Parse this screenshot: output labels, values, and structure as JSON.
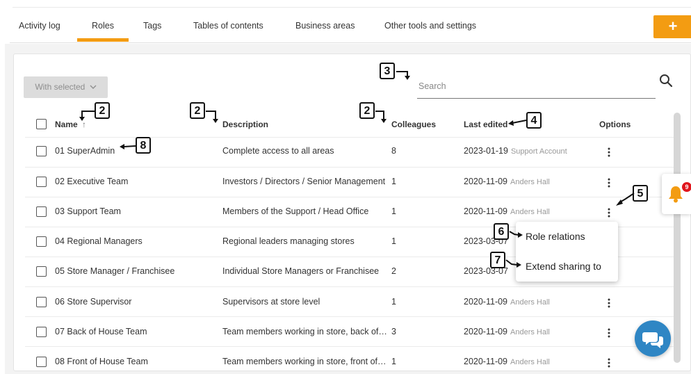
{
  "tabs": [
    {
      "label": "Activity log",
      "active": false
    },
    {
      "label": "Roles",
      "active": true
    },
    {
      "label": "Tags",
      "active": false
    },
    {
      "label": "Tables of contents",
      "active": false
    },
    {
      "label": "Business areas",
      "active": false
    },
    {
      "label": "Other tools and settings",
      "active": false
    }
  ],
  "add_button_label": "+",
  "toolbar": {
    "with_selected_label": "With selected",
    "search_placeholder": "Search"
  },
  "table": {
    "headers": {
      "name": "Name",
      "description": "Description",
      "colleagues": "Colleagues",
      "last_edited": "Last edited",
      "options": "Options"
    },
    "sort_indicator": "↑",
    "rows": [
      {
        "name": "01 SuperAdmin",
        "description": "Complete access to all areas",
        "colleagues": "8",
        "date": "2023-01-19",
        "editor": "Support Account"
      },
      {
        "name": "02 Executive Team",
        "description": "Investors / Directors / Senior Management",
        "colleagues": "1",
        "date": "2020-11-09",
        "editor": "Anders Hall"
      },
      {
        "name": "03 Support Team",
        "description": "Members of the Support / Head Office",
        "colleagues": "1",
        "date": "2020-11-09",
        "editor": "Anders Hall"
      },
      {
        "name": "04 Regional Managers",
        "description": "Regional leaders managing stores",
        "colleagues": "1",
        "date": "2023-03-07",
        "editor": ""
      },
      {
        "name": "05 Store Manager / Franchisee",
        "description": "Individual Store Managers or Franchisee",
        "colleagues": "2",
        "date": "2023-03-07",
        "editor": ""
      },
      {
        "name": "06 Store Supervisor",
        "description": "Supervisors at store level",
        "colleagues": "1",
        "date": "2020-11-09",
        "editor": "Anders Hall"
      },
      {
        "name": "07 Back of House Team",
        "description": "Team members working in store, back of house",
        "colleagues": "3",
        "date": "2020-11-09",
        "editor": "Anders Hall"
      },
      {
        "name": "08 Front of House Team",
        "description": "Team members working in store, front of house",
        "colleagues": "1",
        "date": "2020-11-09",
        "editor": "Anders Hall"
      }
    ]
  },
  "row_menu": {
    "items": [
      "Role relations",
      "Extend sharing to"
    ]
  },
  "notifications": {
    "count": "9"
  },
  "callouts": [
    "2",
    "2",
    "2",
    "3",
    "4",
    "5",
    "6",
    "7",
    "8"
  ],
  "colors": {
    "accent": "#f39c12",
    "chat": "#2f86c4",
    "badge": "#e0161d"
  }
}
